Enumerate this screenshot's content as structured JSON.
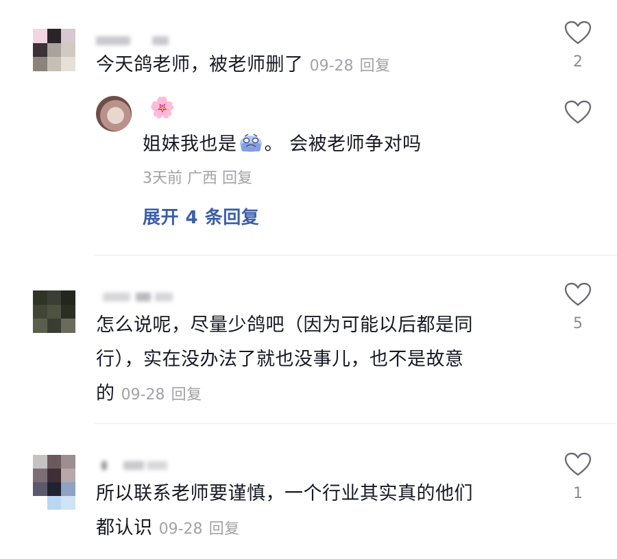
{
  "comments": [
    {
      "text": "今天鸽老师，被老师删了",
      "time": "09-28",
      "reply_label": "回复",
      "likes": "2",
      "reply": {
        "username_emoji": "🌸",
        "text_before": "姐妹我也是",
        "text_after": "。 会被老师争对吗",
        "time": "3天前",
        "location": "广西",
        "reply_label": "回复"
      },
      "expand_label": "展开 4 条回复"
    },
    {
      "line1": "怎么说呢，尽量少鸽吧（因为可能以后都是同",
      "line2": "行），实在没办法了就也没事儿，也不是故意",
      "line3": "的",
      "time": "09-28",
      "reply_label": "回复",
      "likes": "5"
    },
    {
      "line1": "所以联系老师要谨慎，一个行业其实真的他们",
      "line2": "都认识",
      "time": "09-28",
      "reply_label": "回复",
      "likes": "1"
    }
  ],
  "colors": {
    "text": "#161823",
    "meta": "#a1a2a7",
    "expand": "#3b5ea8",
    "divider": "#ebebee"
  },
  "icons": {
    "like": "heart-outline-icon",
    "inline_emoji": "crying-face-emoji"
  }
}
